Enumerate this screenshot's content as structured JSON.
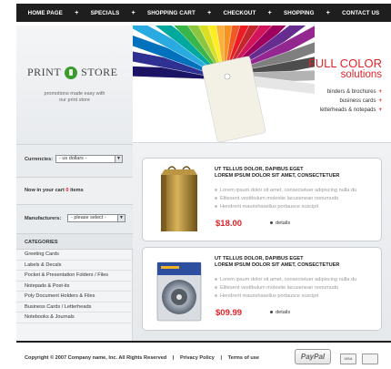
{
  "nav": {
    "items": [
      "HOME PAGE",
      "SPECIALS",
      "SHOPPING CART",
      "CHECKOUT",
      "SHOPPING",
      "CONTACT US"
    ],
    "separator": "+"
  },
  "logo": {
    "left": "PRINT",
    "right": "STORE"
  },
  "tagline": {
    "line1": "promotions made easy with",
    "line2": "our print store"
  },
  "currencies": {
    "label": "Currencies:",
    "selected": "- us dollars -"
  },
  "cart": {
    "prefix": "Now in your cart",
    "count": "0",
    "suffix": "items"
  },
  "manufacturers": {
    "label": "Manufacturers:",
    "selected": "- please select -"
  },
  "categories": {
    "heading": "CATEGORIES",
    "items": [
      "Greeting Cards",
      "Labels & Decals",
      "Pocket & Presentation Folders / Files",
      "Notepads & Post-its",
      "Poly Document Holders & Files",
      "Business Cards / Letterheads",
      "Notebooks & Journals"
    ]
  },
  "banner": {
    "headline": "FULL COLOR",
    "subheadline": "solutions",
    "links": [
      "binders & brochures",
      "business cards",
      "letterheads & notepads"
    ],
    "link_marker": "+"
  },
  "products": [
    {
      "title1": "UT TELLUS DOLOR, DAPIBUS EGET",
      "title2": "LOREM IPSUM DOLOR SIT AMET, CONSECTETUER",
      "bullets": [
        "Lorem ipsum dolor sit amet, consectetuer adipiscing nulla du",
        "Elitesent vestibulum molestie lacusenean nonumudo",
        "Hendrerit maurishasellus portausce suscipit"
      ],
      "price": "$18.00",
      "details": "details"
    },
    {
      "title1": "UT TELLUS DOLOR, DAPIBUS EGET",
      "title2": "LOREM IPSUM DOLOR SIT AMET, CONSECTETUER",
      "bullets": [
        "Lorem ipsum dolor sit amet, consectetuer adipiscing nulla du",
        "Elitesent vestibulum molestie lacusenean nonumudo",
        "Hendrerit maurishasellus portausce suscipit"
      ],
      "price": "$09.99",
      "details": "details"
    }
  ],
  "footer": {
    "copyright": "Copyright © 2007 Company name, Inc. All Rights Reserved",
    "privacy": "Privacy Policy",
    "terms": "Terms of use",
    "separator": "|",
    "paypal": "PayPal",
    "visa": "VISA",
    "mastercard": "MasterCard"
  },
  "colors": {
    "accent_red": "#e0242a",
    "nav_bg": "#1e1e1e",
    "logo_green": "#3c9a2f"
  }
}
